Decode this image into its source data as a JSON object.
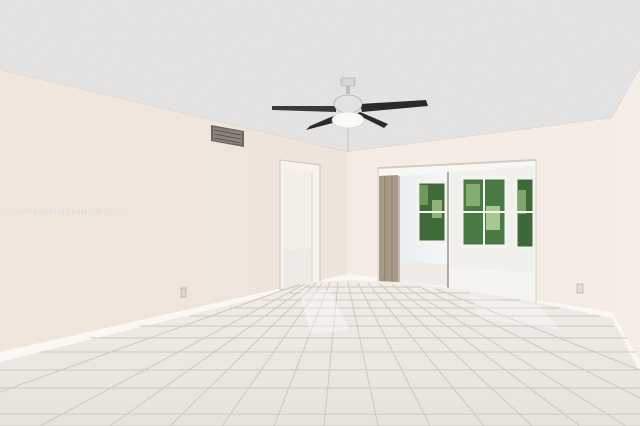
{
  "photo": {
    "watermark_text": "A1163049@© Miami MLS® 2024",
    "colors": {
      "ceiling": "#ecebea",
      "wall_left": "#f3ebe4",
      "wall_center": "#f4ece5",
      "wall_right": "#f5eee8",
      "floor": "#ece9e3",
      "floor_grout": "#cfc8bf",
      "fan_blade": "#2a2a2a",
      "fan_body": "#d9d9d9",
      "curtain": "#a69985",
      "foliage": "#3f6b3a"
    }
  }
}
